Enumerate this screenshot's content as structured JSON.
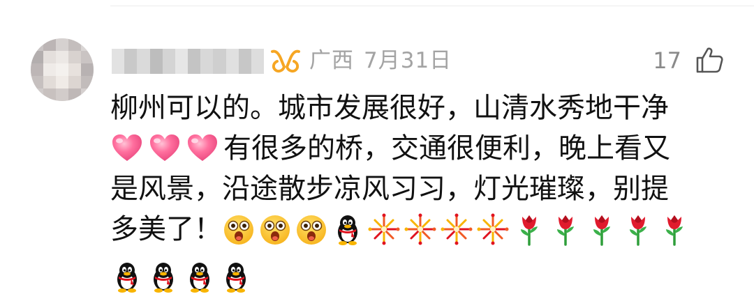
{
  "comment": {
    "location": "广西",
    "date": "7月31日",
    "like_count": "17",
    "text_line1": "柳州可以的。城市发展很好，山清水秀地干净",
    "text_line2": "有很多的桥，交通很便利，晚上看又",
    "text_line3": "是风景，沿途散步凉风习习，灯光璀璨，别提",
    "text_line4": "多美了！"
  },
  "icons": {
    "vip_badge": "vip-badge-icon",
    "like": "thumbs-up-icon",
    "emoji_heart": "pink-heart",
    "emoji_wow": "wow-face",
    "emoji_penguin": "qq-penguin",
    "emoji_firework": "firework",
    "emoji_rose": "red-rose"
  },
  "colors": {
    "vip_badge": "#f6a623",
    "meta_text": "#a3a3a3",
    "body_text": "#111111"
  }
}
